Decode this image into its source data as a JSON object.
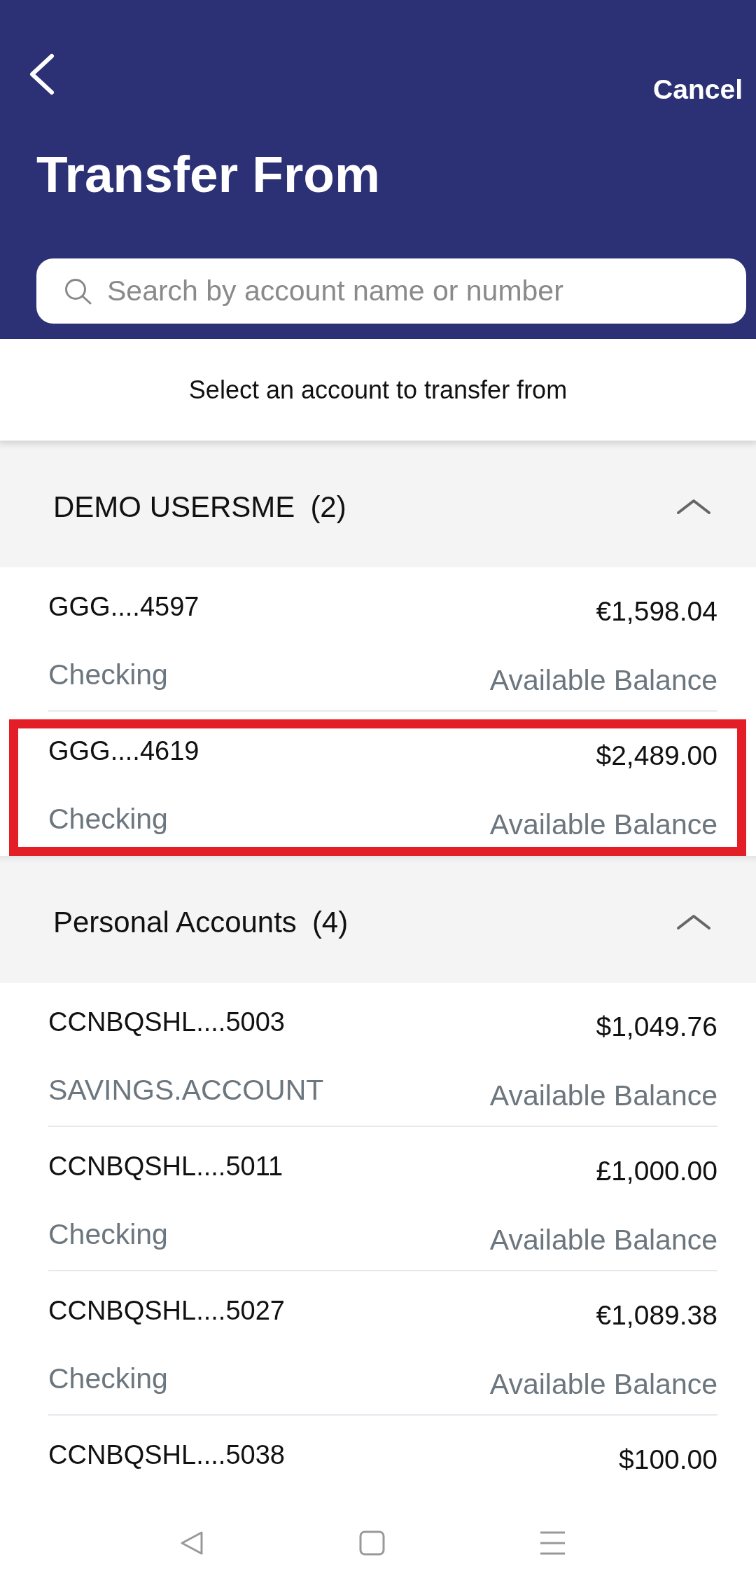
{
  "header": {
    "title": "Transfer From",
    "cancel": "Cancel"
  },
  "search": {
    "placeholder": "Search by account name or number"
  },
  "instruction": "Select an account to transfer from",
  "groups": [
    {
      "name": "DEMO USERSME",
      "count": "(2)",
      "expanded": true,
      "accounts": [
        {
          "name": "GGG....4597",
          "amount": "€1,598.04",
          "type": "Checking",
          "balance_label": "Available Balance",
          "highlighted": false
        },
        {
          "name": "GGG....4619",
          "amount": "$2,489.00",
          "type": "Checking",
          "balance_label": "Available Balance",
          "highlighted": true
        }
      ]
    },
    {
      "name": "Personal Accounts",
      "count": "(4)",
      "expanded": true,
      "accounts": [
        {
          "name": "CCNBQSHL....5003",
          "amount": "$1,049.76",
          "type": "SAVINGS.ACCOUNT",
          "balance_label": "Available Balance",
          "highlighted": false
        },
        {
          "name": "CCNBQSHL....5011",
          "amount": "£1,000.00",
          "type": "Checking",
          "balance_label": "Available Balance",
          "highlighted": false
        },
        {
          "name": "CCNBQSHL....5027",
          "amount": "€1,089.38",
          "type": "Checking",
          "balance_label": "Available Balance",
          "highlighted": false
        },
        {
          "name": "CCNBQSHL....5038",
          "amount": "$100.00",
          "highlighted": false
        }
      ]
    }
  ]
}
